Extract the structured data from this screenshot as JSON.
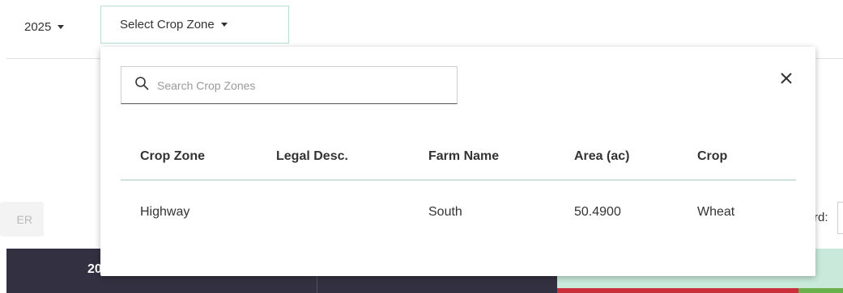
{
  "toolbar": {
    "year": "2025",
    "crop_zone_select_label": "Select Crop Zone"
  },
  "background": {
    "filter_button_partial": "ER",
    "right_label_partial": "rd:",
    "grid_header_partial": "20"
  },
  "dropdown": {
    "search_placeholder": "Search Crop Zones",
    "search_value": "",
    "close_icon": "close-icon",
    "columns": [
      "Crop Zone",
      "Legal Desc.",
      "Farm Name",
      "Area (ac)",
      "Crop"
    ],
    "rows": [
      {
        "crop_zone": "Highway",
        "legal_desc": "",
        "farm_name": "South",
        "area": "50.4900",
        "crop": "Wheat"
      }
    ]
  },
  "colors": {
    "accent_border": "#b9dfd3",
    "grid_header_bg": "#333141",
    "status_red": "#c9303b",
    "status_green": "#6ab04c"
  }
}
